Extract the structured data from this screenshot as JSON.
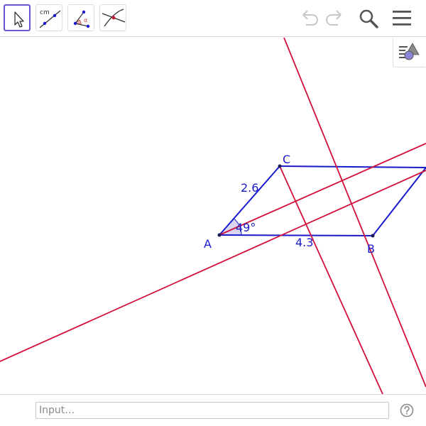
{
  "toolbar": {
    "tools": [
      {
        "name": "Move",
        "icon": "move-arrow-icon",
        "selected": true
      },
      {
        "name": "Segment with Given Length",
        "icon": "segment-length-icon",
        "label": "cm"
      },
      {
        "name": "Angle with Given Size",
        "icon": "angle-icon",
        "label": "α"
      },
      {
        "name": "Intersect",
        "icon": "intersect-icon"
      }
    ],
    "undo_icon": "undo-icon",
    "redo_icon": "redo-icon",
    "search_icon": "search-icon",
    "menu_icon": "hamburger-menu-icon"
  },
  "stylebar": {
    "icon": "style-bar-toggle-icon"
  },
  "graphics": {
    "points": {
      "A": "A",
      "B": "B",
      "C": "C"
    },
    "segment_labels": {
      "AC": "2.6",
      "AB": "4.3"
    },
    "angle_label": "49°",
    "colors": {
      "polygon": "#1a1acc",
      "lines": "#d0103a",
      "angle_fill": "#b9b3e6"
    }
  },
  "input_bar": {
    "placeholder": "Input…",
    "value": "",
    "help_icon": "help-icon"
  }
}
